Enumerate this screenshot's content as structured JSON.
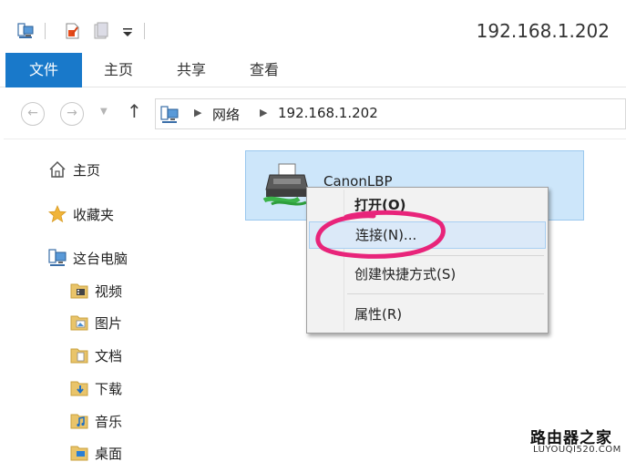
{
  "window": {
    "title": "192.168.1.202"
  },
  "quick_access": {
    "icons": [
      "computer-icon",
      "properties-icon",
      "new-folder-icon",
      "dropdown-icon"
    ]
  },
  "ribbon": {
    "tabs": [
      {
        "label": "文件",
        "active": true
      },
      {
        "label": "主页"
      },
      {
        "label": "共享"
      },
      {
        "label": "查看"
      }
    ],
    "accent": "#1979ca"
  },
  "address": {
    "crumbs": [
      "网络",
      "192.168.1.202"
    ]
  },
  "nav_pane": {
    "home": "主页",
    "favorites": "收藏夹",
    "this_pc": "这台电脑",
    "folders": [
      "视频",
      "图片",
      "文档",
      "下载",
      "音乐",
      "桌面"
    ]
  },
  "content": {
    "printer_name": "CanonLBP"
  },
  "context_menu": {
    "items": [
      {
        "label": "打开(O)",
        "bold": true
      },
      {
        "label": "连接(N)...",
        "highlighted": true
      },
      {
        "label": "创建快捷方式(S)"
      },
      {
        "label": "属性(R)"
      }
    ],
    "highlight_color": "#dbe9f8"
  },
  "watermark": {
    "line1": "路由器之家",
    "line2": "LUYOUQI520.COM"
  },
  "annotation_color": "#e8247a"
}
